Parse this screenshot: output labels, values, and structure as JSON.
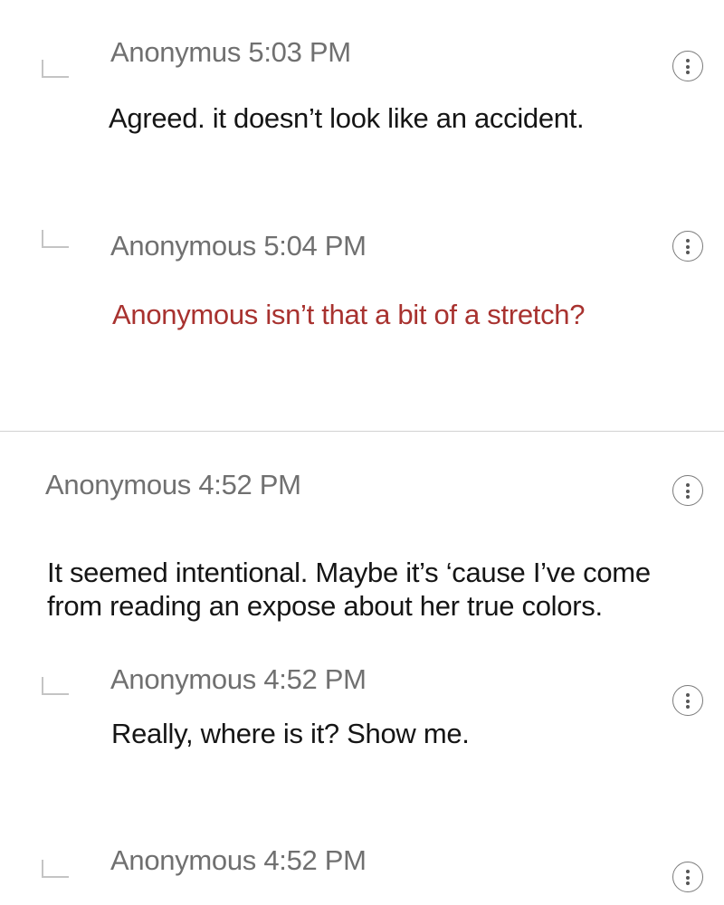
{
  "comments": [
    {
      "author": "Anonymus",
      "time": "5:03 PM",
      "text": "Agreed. it doesn’t look like an accident.",
      "icon": "more-options-icon"
    },
    {
      "author": "Anonymous",
      "time": "5:04 PM",
      "text": "Anonymous isn’t that a bit of a stretch?",
      "text_color": "#a8322f",
      "icon": "more-options-icon"
    },
    {
      "author": "Anonymous",
      "time": "4:52 PM",
      "text": "It seemed intentional. Maybe it’s ‘cause I’ve come from reading an expose about her true colors.",
      "icon": "more-options-icon"
    },
    {
      "author": "Anonymous",
      "time": "4:52 PM",
      "text": "Really, where is it?  Show me.",
      "icon": "more-options-icon"
    },
    {
      "author": "Anonymous",
      "time": "4:52 PM",
      "text": "",
      "icon": "more-options-icon"
    }
  ]
}
